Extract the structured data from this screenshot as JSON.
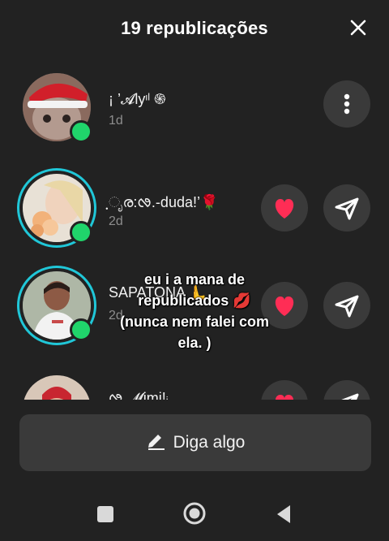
{
  "header": {
    "title": "19 republicações"
  },
  "repost_list": [
    {
      "name": "¡ ’𝓐lyᶦˡ ֍",
      "time": "1d",
      "actions": [
        "more"
      ]
    },
    {
      "name": "ฺೃര:ᰒ.-duda!’🌹",
      "time": "2d",
      "actions": [
        "like",
        "send"
      ]
    },
    {
      "name": "SAPATONA 🫷",
      "time": "2d",
      "actions": [
        "like",
        "send"
      ]
    },
    {
      "name": "ᰒ 𝓜imi!ᵢ",
      "time": "",
      "actions": [
        "like",
        "send"
      ]
    }
  ],
  "caption_overlay": {
    "lines": [
      "eu i a mana de",
      "republicados 💋",
      "(nunca nem falei com",
      "ela. )"
    ]
  },
  "composer": {
    "label": "Diga algo"
  },
  "colors": {
    "background": "#222222",
    "button": "#3a3a3a",
    "heart": "#ff2d55",
    "online": "#20d46b",
    "story_ring": "#20c7d8"
  },
  "icons": {
    "close": "close-icon",
    "more": "more-vertical-icon",
    "like": "heart-icon",
    "send": "send-icon",
    "compose": "pencil-icon",
    "nav": [
      "square-icon",
      "circle-icon",
      "triangle-back-icon"
    ]
  }
}
